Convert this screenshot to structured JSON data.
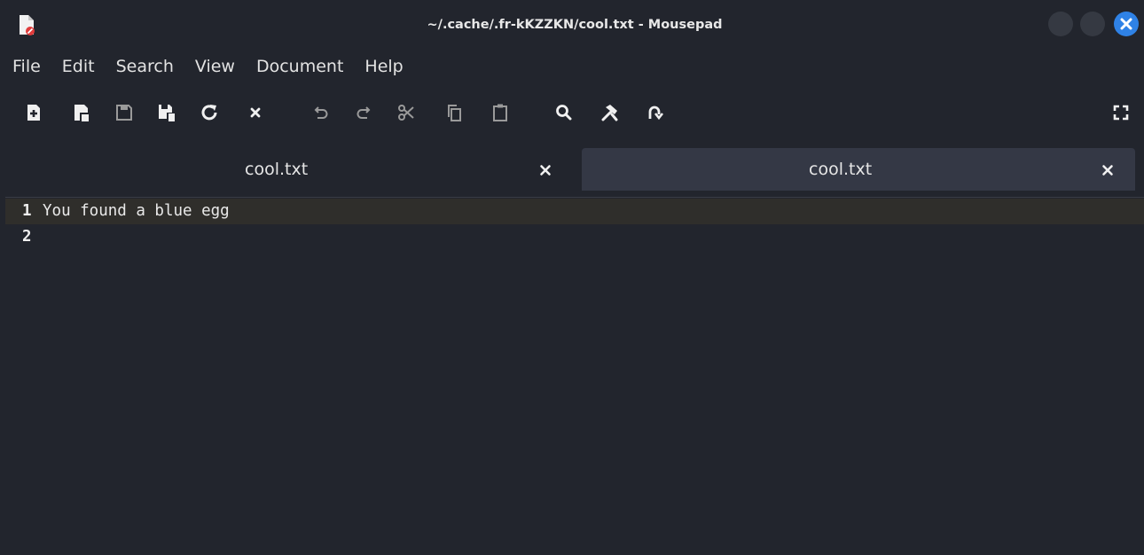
{
  "window": {
    "title": "~/.cache/.fr-kKZZKN/cool.txt - Mousepad",
    "app_icon": "mousepad-app-icon",
    "buttons": [
      "minimize-button",
      "maximize-button",
      "close-button"
    ],
    "close_color": "#2f82e6"
  },
  "menu": {
    "items": [
      "File",
      "Edit",
      "Search",
      "View",
      "Document",
      "Help"
    ]
  },
  "toolbar": {
    "icons": [
      "new-document-icon",
      "new-window-icon",
      "save-icon",
      "save-as-icon",
      "reload-icon",
      "close-document-icon",
      "undo-icon",
      "redo-icon",
      "cut-icon",
      "copy-icon",
      "paste-icon",
      "search-icon",
      "search-replace-icon",
      "go-to-line-icon",
      "fullscreen-icon"
    ]
  },
  "tabs": [
    {
      "label": "cool.txt",
      "active": false
    },
    {
      "label": "cool.txt",
      "active": true
    }
  ],
  "editor": {
    "lines": [
      {
        "number": "1",
        "text": "You found a blue egg",
        "current": true
      },
      {
        "number": "2",
        "text": "",
        "current": false
      }
    ],
    "current_line_color": "#2f2e2b"
  },
  "colors": {
    "background": "#22252d",
    "active_tab": "#343845"
  }
}
